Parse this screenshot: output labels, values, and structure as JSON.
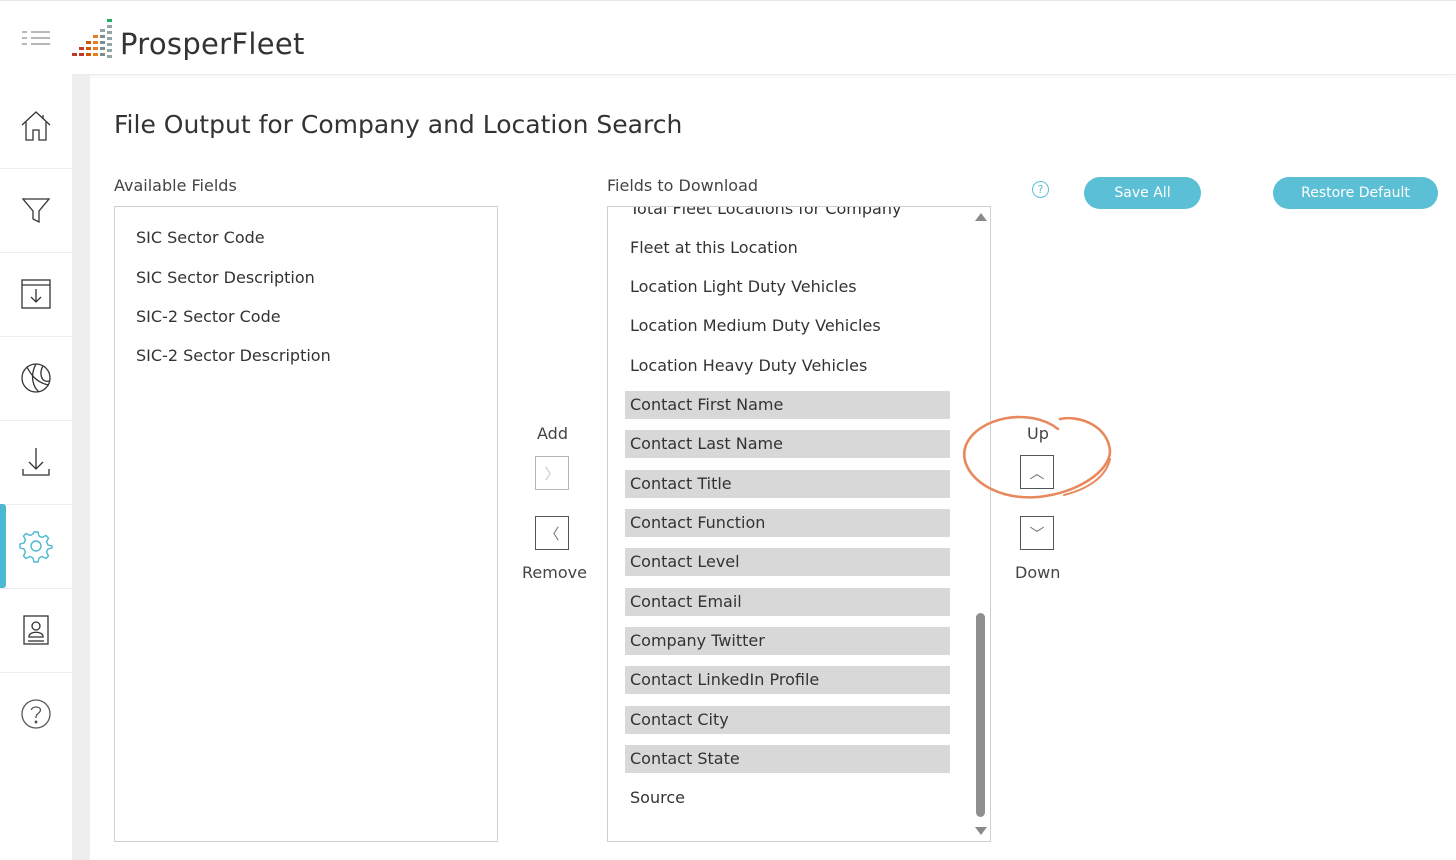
{
  "app": {
    "name": "ProsperFleet",
    "logo_colors": [
      "#c0392b",
      "#d35400",
      "#e67e22",
      "#7f8c8d",
      "#95a5a6",
      "#27ae60"
    ]
  },
  "sidebar": {
    "items": [
      {
        "icon": "home-icon",
        "active": false
      },
      {
        "icon": "filter-icon",
        "active": false
      },
      {
        "icon": "save-download-icon",
        "active": false
      },
      {
        "icon": "ball-icon",
        "active": false
      },
      {
        "icon": "download-icon",
        "active": false
      },
      {
        "icon": "settings-gear-icon",
        "active": true
      },
      {
        "icon": "contact-card-icon",
        "active": false
      },
      {
        "icon": "help-icon",
        "active": false
      }
    ],
    "accent_color": "#4db8d1"
  },
  "page": {
    "title": "File Output for Company and Location Search"
  },
  "available": {
    "label": "Available Fields",
    "items": [
      "SIC Sector Code",
      "SIC Sector Description",
      "SIC-2 Sector Code",
      "SIC-2 Sector Description"
    ]
  },
  "download": {
    "label": "Fields to Download",
    "items": [
      {
        "text": "Total Fleet Locations for Company",
        "selected": false
      },
      {
        "text": "Fleet at this Location",
        "selected": false
      },
      {
        "text": "Location Light Duty Vehicles",
        "selected": false
      },
      {
        "text": "Location Medium Duty Vehicles",
        "selected": false
      },
      {
        "text": "Location Heavy Duty Vehicles",
        "selected": false
      },
      {
        "text": "Contact First Name",
        "selected": true
      },
      {
        "text": "Contact Last Name",
        "selected": true
      },
      {
        "text": "Contact Title",
        "selected": true
      },
      {
        "text": "Contact Function",
        "selected": true
      },
      {
        "text": "Contact Level",
        "selected": true
      },
      {
        "text": "Contact Email",
        "selected": true
      },
      {
        "text": "Company Twitter",
        "selected": true
      },
      {
        "text": "Contact LinkedIn Profile",
        "selected": true
      },
      {
        "text": "Contact City",
        "selected": true
      },
      {
        "text": "Contact State",
        "selected": true
      },
      {
        "text": "Source",
        "selected": false
      }
    ]
  },
  "transfer": {
    "add_label": "Add",
    "remove_label": "Remove",
    "add_glyph": "〉",
    "remove_glyph": "〈"
  },
  "order": {
    "up_label": "Up",
    "down_label": "Down",
    "up_glyph": "︿",
    "down_glyph": "﹀"
  },
  "actions": {
    "help_glyph": "?",
    "save_all": "Save All",
    "restore_default": "Restore Default",
    "button_color": "#5bbfd6"
  },
  "annotation_color": "#e8895d"
}
